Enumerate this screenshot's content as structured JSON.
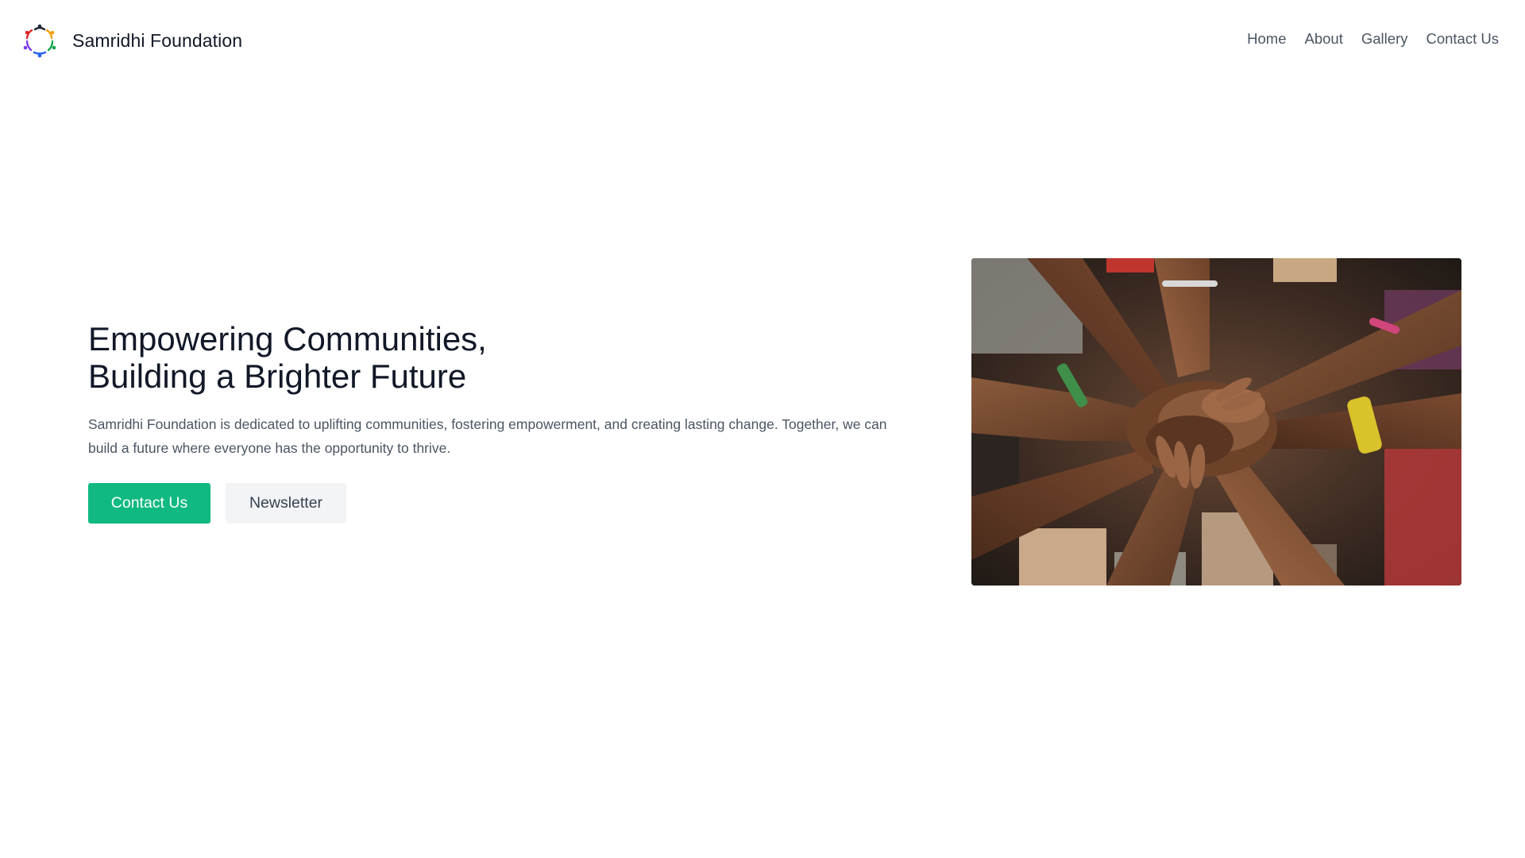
{
  "header": {
    "brand_name": "Samridhi Foundation",
    "logo_icon": "circle-of-people-logo-icon",
    "nav": [
      {
        "label": "Home"
      },
      {
        "label": "About"
      },
      {
        "label": "Gallery"
      },
      {
        "label": "Contact Us"
      }
    ]
  },
  "hero": {
    "title_line_1": "Empowering Communities,",
    "title_line_2": "Building a Brighter Future",
    "description": "Samridhi Foundation is dedicated to uplifting communities, fostering empowerment, and creating lasting change. Together, we can build a future where everyone has the opportunity to thrive.",
    "primary_button": "Contact Us",
    "secondary_button": "Newsletter",
    "image_subject": "stacked-hands-photo"
  },
  "colors": {
    "accent": "#10b981",
    "text_dark": "#111827",
    "text_muted": "#4b5563",
    "secondary_button_bg": "#f3f4f6"
  }
}
